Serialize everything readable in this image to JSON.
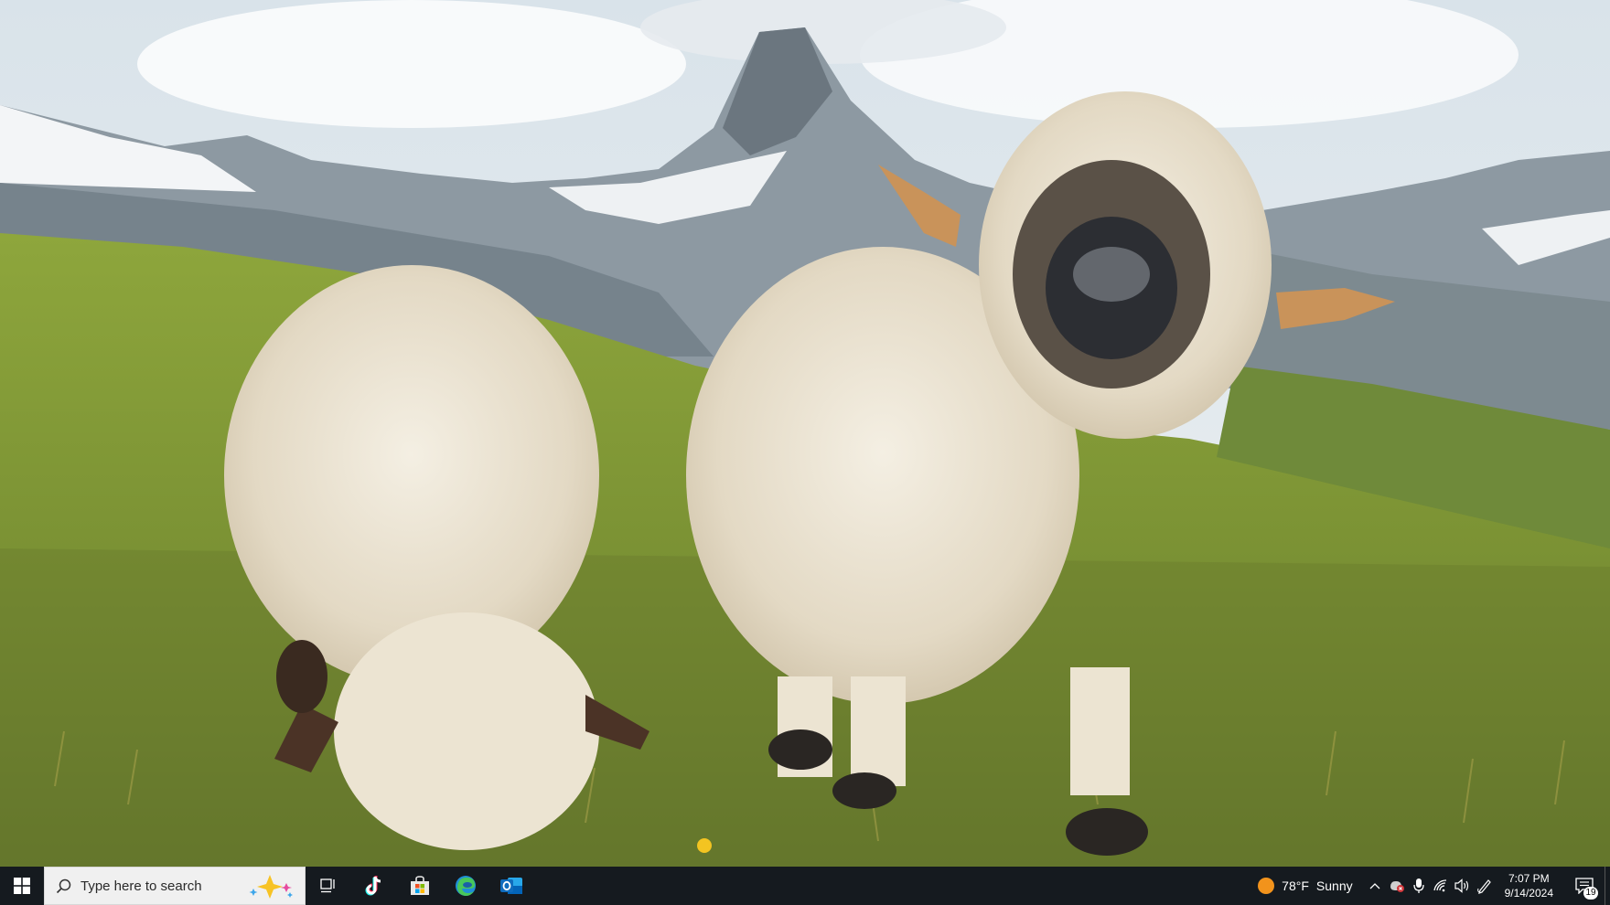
{
  "search": {
    "placeholder": "Type here to search"
  },
  "taskbar_apps": [
    {
      "name": "task-view-icon"
    },
    {
      "name": "tiktok-icon"
    },
    {
      "name": "microsoft-store-icon"
    },
    {
      "name": "edge-icon"
    },
    {
      "name": "outlook-icon"
    }
  ],
  "weather": {
    "temperature": "78°F",
    "condition": "Sunny"
  },
  "clock": {
    "time": "7:07 PM",
    "date": "9/14/2024"
  },
  "notifications": {
    "count": "19"
  },
  "colors": {
    "taskbar": "#151a1f",
    "search_bg": "#f0f0f0",
    "weather_sun": "#f2931c"
  }
}
